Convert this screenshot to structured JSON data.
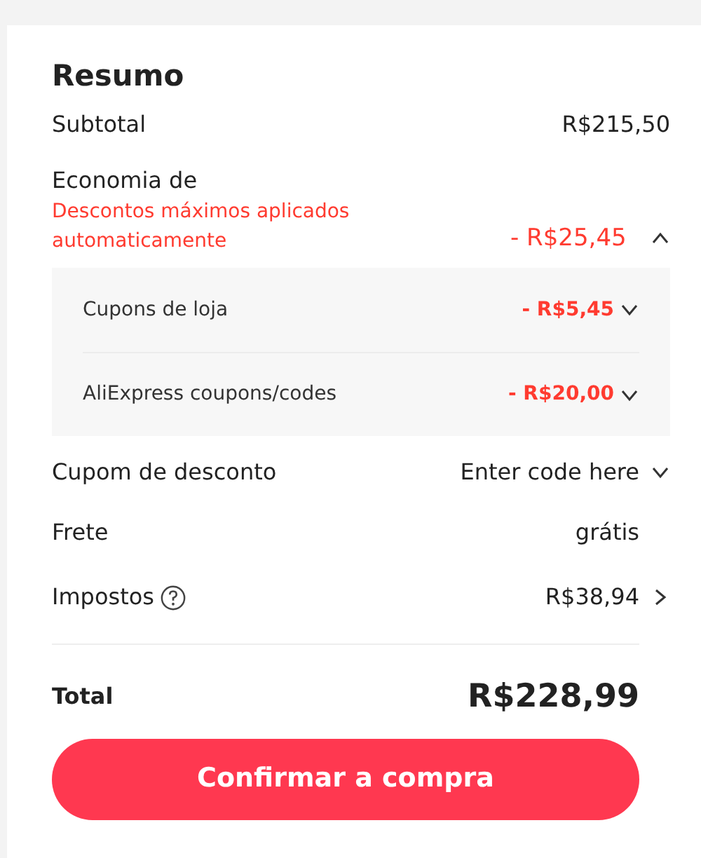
{
  "summary": {
    "title": "Resumo",
    "subtotal": {
      "label": "Subtotal",
      "value": "R$215,50"
    },
    "savings": {
      "label": "Economia de",
      "note": "Descontos máximos aplicados automaticamente",
      "value": "- R$25,45",
      "expanded": true,
      "items": [
        {
          "label": "Cupons de loja",
          "value": "- R$5,45",
          "expanded": false
        },
        {
          "label": "AliExpress coupons/codes",
          "value": "- R$20,00",
          "expanded": false
        }
      ]
    },
    "coupon": {
      "label": "Cupom de desconto",
      "placeholder": "Enter code here",
      "expanded": false
    },
    "shipping": {
      "label": "Frete",
      "value": "grátis"
    },
    "taxes": {
      "label": "Impostos",
      "value": "R$38,94"
    },
    "total": {
      "label": "Total",
      "value": "R$228,99"
    },
    "confirm_button": "Confirmar a compra"
  }
}
